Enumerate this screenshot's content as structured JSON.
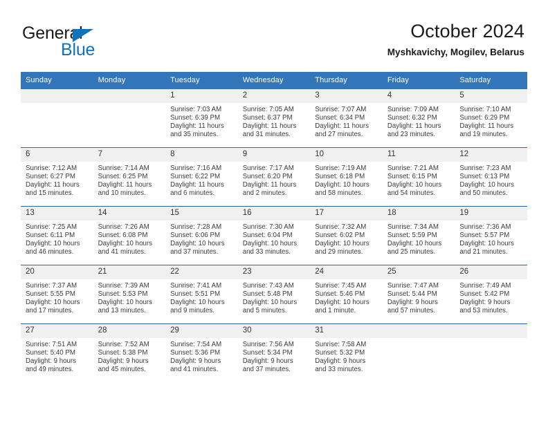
{
  "brand": {
    "name_part1": "General",
    "name_part2": "Blue",
    "triangle_color": "#1072ba"
  },
  "header": {
    "title": "October 2024",
    "subtitle": "Myshkavichy, Mogilev, Belarus"
  },
  "colors": {
    "header_row": "#3275b9",
    "row_separator": "#2a64a4",
    "daynum_band": "#f0f0f0",
    "brand_blue": "#1072ba"
  },
  "weekday_headers": [
    "Sunday",
    "Monday",
    "Tuesday",
    "Wednesday",
    "Thursday",
    "Friday",
    "Saturday"
  ],
  "labels": {
    "sunrise_prefix": "Sunrise:",
    "sunset_prefix": "Sunset:",
    "daylight_prefix": "Daylight:"
  },
  "weeks": [
    [
      {
        "day": "",
        "empty": true,
        "sunrise": "",
        "sunset": "",
        "daylight": ""
      },
      {
        "day": "",
        "empty": true,
        "sunrise": "",
        "sunset": "",
        "daylight": ""
      },
      {
        "day": "1",
        "empty": false,
        "sunrise": "Sunrise: 7:03 AM",
        "sunset": "Sunset: 6:39 PM",
        "daylight": "Daylight: 11 hours and 35 minutes."
      },
      {
        "day": "2",
        "empty": false,
        "sunrise": "Sunrise: 7:05 AM",
        "sunset": "Sunset: 6:37 PM",
        "daylight": "Daylight: 11 hours and 31 minutes."
      },
      {
        "day": "3",
        "empty": false,
        "sunrise": "Sunrise: 7:07 AM",
        "sunset": "Sunset: 6:34 PM",
        "daylight": "Daylight: 11 hours and 27 minutes."
      },
      {
        "day": "4",
        "empty": false,
        "sunrise": "Sunrise: 7:09 AM",
        "sunset": "Sunset: 6:32 PM",
        "daylight": "Daylight: 11 hours and 23 minutes."
      },
      {
        "day": "5",
        "empty": false,
        "sunrise": "Sunrise: 7:10 AM",
        "sunset": "Sunset: 6:29 PM",
        "daylight": "Daylight: 11 hours and 19 minutes."
      }
    ],
    [
      {
        "day": "6",
        "empty": false,
        "sunrise": "Sunrise: 7:12 AM",
        "sunset": "Sunset: 6:27 PM",
        "daylight": "Daylight: 11 hours and 15 minutes."
      },
      {
        "day": "7",
        "empty": false,
        "sunrise": "Sunrise: 7:14 AM",
        "sunset": "Sunset: 6:25 PM",
        "daylight": "Daylight: 11 hours and 10 minutes."
      },
      {
        "day": "8",
        "empty": false,
        "sunrise": "Sunrise: 7:16 AM",
        "sunset": "Sunset: 6:22 PM",
        "daylight": "Daylight: 11 hours and 6 minutes."
      },
      {
        "day": "9",
        "empty": false,
        "sunrise": "Sunrise: 7:17 AM",
        "sunset": "Sunset: 6:20 PM",
        "daylight": "Daylight: 11 hours and 2 minutes."
      },
      {
        "day": "10",
        "empty": false,
        "sunrise": "Sunrise: 7:19 AM",
        "sunset": "Sunset: 6:18 PM",
        "daylight": "Daylight: 10 hours and 58 minutes."
      },
      {
        "day": "11",
        "empty": false,
        "sunrise": "Sunrise: 7:21 AM",
        "sunset": "Sunset: 6:15 PM",
        "daylight": "Daylight: 10 hours and 54 minutes."
      },
      {
        "day": "12",
        "empty": false,
        "sunrise": "Sunrise: 7:23 AM",
        "sunset": "Sunset: 6:13 PM",
        "daylight": "Daylight: 10 hours and 50 minutes."
      }
    ],
    [
      {
        "day": "13",
        "empty": false,
        "sunrise": "Sunrise: 7:25 AM",
        "sunset": "Sunset: 6:11 PM",
        "daylight": "Daylight: 10 hours and 46 minutes."
      },
      {
        "day": "14",
        "empty": false,
        "sunrise": "Sunrise: 7:26 AM",
        "sunset": "Sunset: 6:08 PM",
        "daylight": "Daylight: 10 hours and 41 minutes."
      },
      {
        "day": "15",
        "empty": false,
        "sunrise": "Sunrise: 7:28 AM",
        "sunset": "Sunset: 6:06 PM",
        "daylight": "Daylight: 10 hours and 37 minutes."
      },
      {
        "day": "16",
        "empty": false,
        "sunrise": "Sunrise: 7:30 AM",
        "sunset": "Sunset: 6:04 PM",
        "daylight": "Daylight: 10 hours and 33 minutes."
      },
      {
        "day": "17",
        "empty": false,
        "sunrise": "Sunrise: 7:32 AM",
        "sunset": "Sunset: 6:02 PM",
        "daylight": "Daylight: 10 hours and 29 minutes."
      },
      {
        "day": "18",
        "empty": false,
        "sunrise": "Sunrise: 7:34 AM",
        "sunset": "Sunset: 5:59 PM",
        "daylight": "Daylight: 10 hours and 25 minutes."
      },
      {
        "day": "19",
        "empty": false,
        "sunrise": "Sunrise: 7:36 AM",
        "sunset": "Sunset: 5:57 PM",
        "daylight": "Daylight: 10 hours and 21 minutes."
      }
    ],
    [
      {
        "day": "20",
        "empty": false,
        "sunrise": "Sunrise: 7:37 AM",
        "sunset": "Sunset: 5:55 PM",
        "daylight": "Daylight: 10 hours and 17 minutes."
      },
      {
        "day": "21",
        "empty": false,
        "sunrise": "Sunrise: 7:39 AM",
        "sunset": "Sunset: 5:53 PM",
        "daylight": "Daylight: 10 hours and 13 minutes."
      },
      {
        "day": "22",
        "empty": false,
        "sunrise": "Sunrise: 7:41 AM",
        "sunset": "Sunset: 5:51 PM",
        "daylight": "Daylight: 10 hours and 9 minutes."
      },
      {
        "day": "23",
        "empty": false,
        "sunrise": "Sunrise: 7:43 AM",
        "sunset": "Sunset: 5:48 PM",
        "daylight": "Daylight: 10 hours and 5 minutes."
      },
      {
        "day": "24",
        "empty": false,
        "sunrise": "Sunrise: 7:45 AM",
        "sunset": "Sunset: 5:46 PM",
        "daylight": "Daylight: 10 hours and 1 minute."
      },
      {
        "day": "25",
        "empty": false,
        "sunrise": "Sunrise: 7:47 AM",
        "sunset": "Sunset: 5:44 PM",
        "daylight": "Daylight: 9 hours and 57 minutes."
      },
      {
        "day": "26",
        "empty": false,
        "sunrise": "Sunrise: 7:49 AM",
        "sunset": "Sunset: 5:42 PM",
        "daylight": "Daylight: 9 hours and 53 minutes."
      }
    ],
    [
      {
        "day": "27",
        "empty": false,
        "sunrise": "Sunrise: 7:51 AM",
        "sunset": "Sunset: 5:40 PM",
        "daylight": "Daylight: 9 hours and 49 minutes."
      },
      {
        "day": "28",
        "empty": false,
        "sunrise": "Sunrise: 7:52 AM",
        "sunset": "Sunset: 5:38 PM",
        "daylight": "Daylight: 9 hours and 45 minutes."
      },
      {
        "day": "29",
        "empty": false,
        "sunrise": "Sunrise: 7:54 AM",
        "sunset": "Sunset: 5:36 PM",
        "daylight": "Daylight: 9 hours and 41 minutes."
      },
      {
        "day": "30",
        "empty": false,
        "sunrise": "Sunrise: 7:56 AM",
        "sunset": "Sunset: 5:34 PM",
        "daylight": "Daylight: 9 hours and 37 minutes."
      },
      {
        "day": "31",
        "empty": false,
        "sunrise": "Sunrise: 7:58 AM",
        "sunset": "Sunset: 5:32 PM",
        "daylight": "Daylight: 9 hours and 33 minutes."
      },
      {
        "day": "",
        "empty": true,
        "sunrise": "",
        "sunset": "",
        "daylight": ""
      },
      {
        "day": "",
        "empty": true,
        "sunrise": "",
        "sunset": "",
        "daylight": ""
      }
    ]
  ]
}
